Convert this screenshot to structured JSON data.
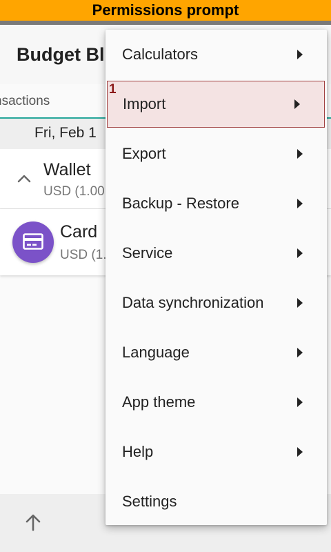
{
  "prompt_banner": "Permissions prompt",
  "app_title": "Budget Bl",
  "tab_label": "nsactions",
  "date": "Fri, Feb 1",
  "accounts": [
    {
      "name": "Wallet",
      "sub": "USD (1.00"
    },
    {
      "name": "Card",
      "sub": "USD (1."
    }
  ],
  "menu": {
    "items": [
      {
        "label": "Calculators",
        "has_submenu": true
      },
      {
        "label": "Import",
        "has_submenu": true,
        "highlighted": true,
        "number": "1"
      },
      {
        "label": "Export",
        "has_submenu": true
      },
      {
        "label": "Backup - Restore",
        "has_submenu": true
      },
      {
        "label": "Service",
        "has_submenu": true
      },
      {
        "label": "Data synchronization",
        "has_submenu": true
      },
      {
        "label": "Language",
        "has_submenu": true
      },
      {
        "label": "App theme",
        "has_submenu": true
      },
      {
        "label": "Help",
        "has_submenu": true
      },
      {
        "label": "Settings",
        "has_submenu": false
      }
    ]
  },
  "icons": {
    "submenu": "chevron-right-icon",
    "wallet_toggle": "chevron-up-icon",
    "card_avatar": "credit-card-icon",
    "bottom": "arrow-up-icon"
  },
  "colors": {
    "prompt_bar": "#FFA500",
    "accent_teal": "#26a69a",
    "card_purple": "#7b52c8",
    "highlight_fill": "#f4e3e3",
    "highlight_border": "#a04040",
    "highlight_number": "#8b1a1a"
  }
}
